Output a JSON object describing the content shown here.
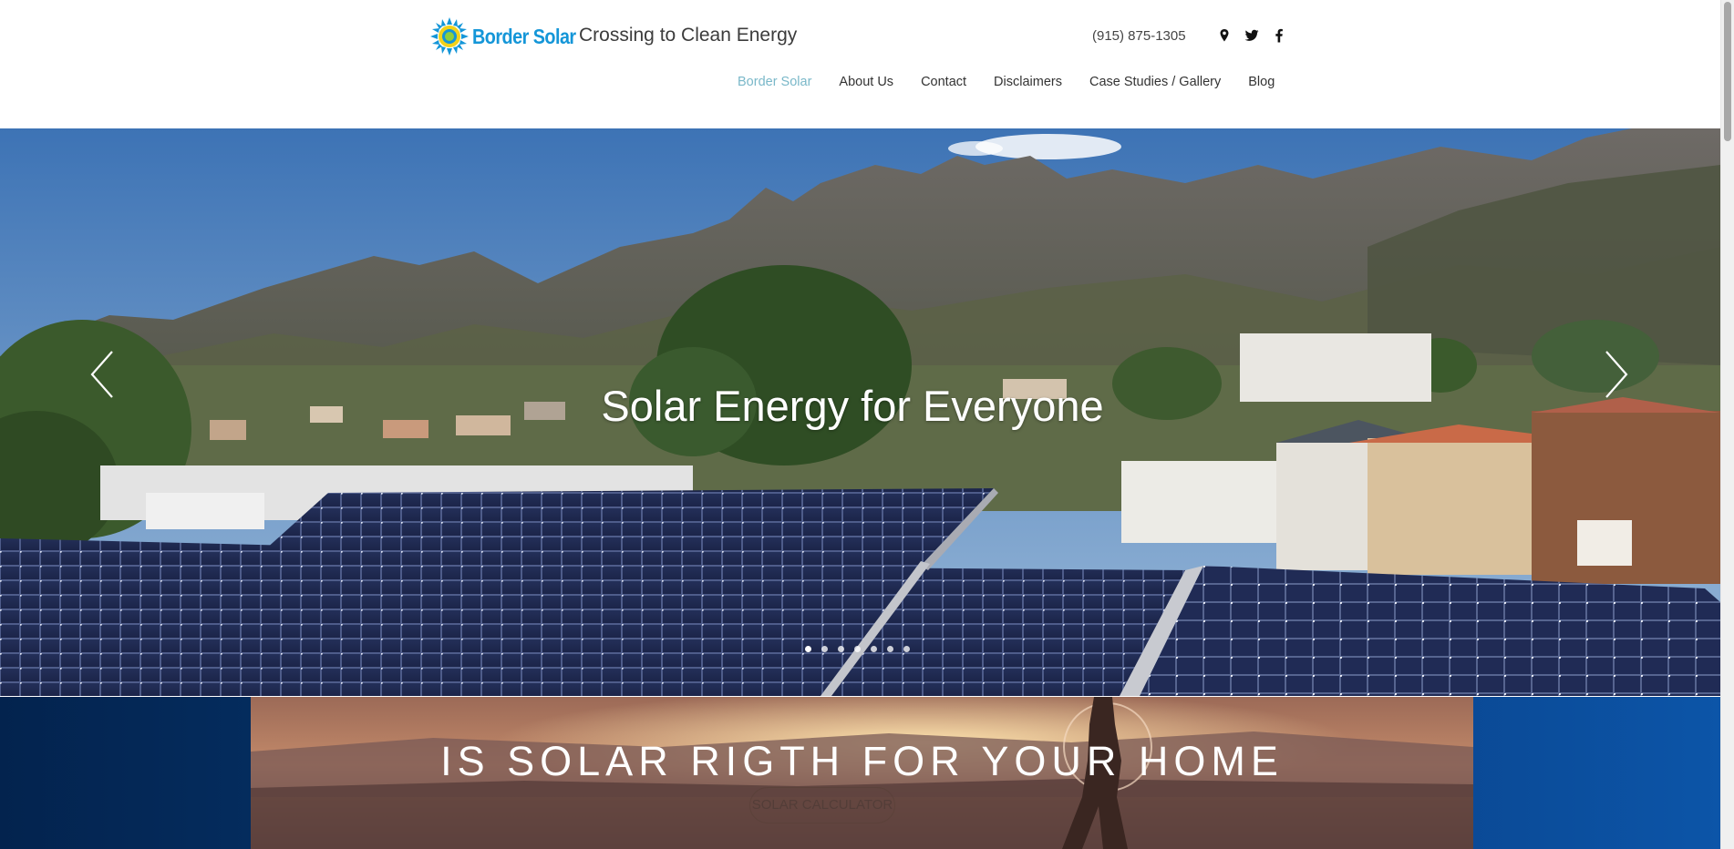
{
  "header": {
    "logo_text": "Border Solar",
    "tagline": "Crossing to Clean Energy",
    "phone": "(915) 875-1305",
    "social_icons": [
      "map-pin-icon",
      "twitter-icon",
      "facebook-icon"
    ]
  },
  "nav": {
    "items": [
      {
        "label": "Border Solar",
        "active": true
      },
      {
        "label": "About Us",
        "active": false
      },
      {
        "label": "Contact",
        "active": false
      },
      {
        "label": "Disclaimers",
        "active": false
      },
      {
        "label": "Case Studies / Gallery",
        "active": false
      },
      {
        "label": "Blog",
        "active": false
      }
    ]
  },
  "hero": {
    "title": "Solar Energy for Everyone",
    "prev_icon": "chevron-left-icon",
    "next_icon": "chevron-right-icon",
    "slide_count": 7,
    "active_slide": 1
  },
  "strip": {
    "title": "IS SOLAR RIGTH FOR YOUR HOME",
    "button_label": "SOLAR CALCULATOR"
  },
  "colors": {
    "brand_blue": "#1496d8",
    "logo_sun_yellow": "#f2d21b",
    "nav_active": "#7ab8c9",
    "strip_navy": "#052f63"
  }
}
